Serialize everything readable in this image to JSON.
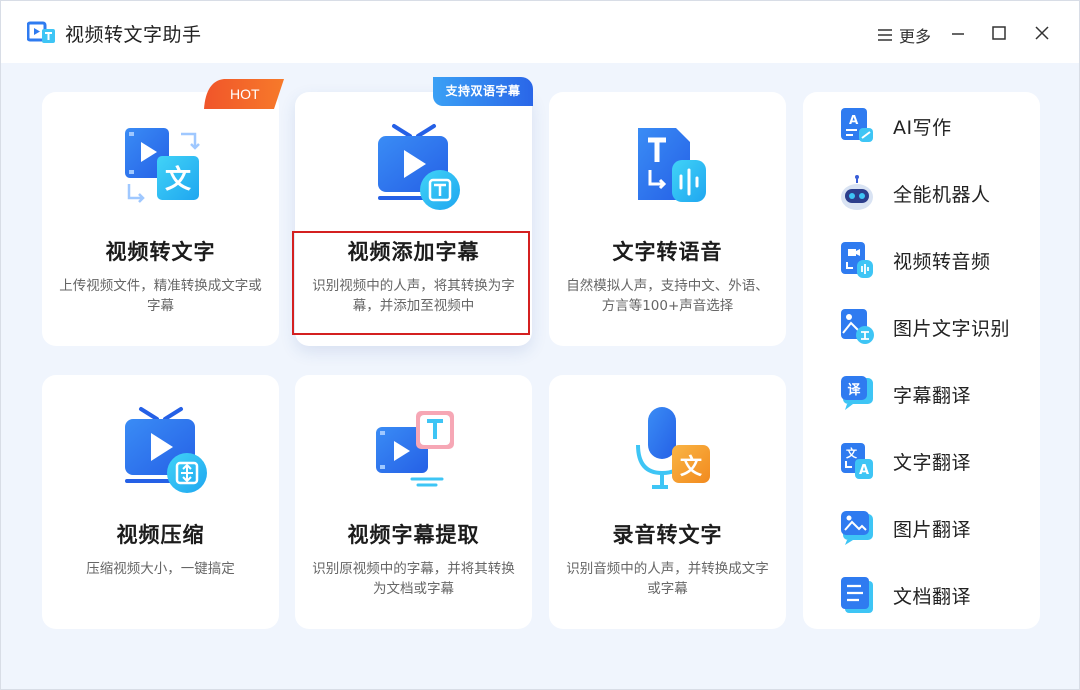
{
  "window": {
    "title": "视频转文字助手",
    "more_label": "更多"
  },
  "cards": [
    {
      "title": "视频转文字",
      "desc": "上传视频文件，精准转换成文字或字幕",
      "badge": "HOT"
    },
    {
      "title": "视频添加字幕",
      "desc": "识别视频中的人声，将其转换为字幕，并添加至视频中",
      "badge": "支持双语字幕"
    },
    {
      "title": "文字转语音",
      "desc": "自然模拟人声，支持中文、外语、方言等100+声音选择"
    },
    {
      "title": "视频压缩",
      "desc": "压缩视频大小，一键搞定"
    },
    {
      "title": "视频字幕提取",
      "desc": "识别原视频中的字幕，并将其转换为文档或字幕"
    },
    {
      "title": "录音转文字",
      "desc": "识别音频中的人声，并转换成文字或字幕"
    }
  ],
  "sidebar": {
    "items": [
      {
        "label": "AI写作",
        "icon": "ai-writing-icon"
      },
      {
        "label": "全能机器人",
        "icon": "robot-icon"
      },
      {
        "label": "视频转音频",
        "icon": "video-to-audio-icon"
      },
      {
        "label": "图片文字识别",
        "icon": "image-ocr-icon"
      },
      {
        "label": "字幕翻译",
        "icon": "subtitle-translate-icon"
      },
      {
        "label": "文字翻译",
        "icon": "text-translate-icon"
      },
      {
        "label": "图片翻译",
        "icon": "image-translate-icon"
      },
      {
        "label": "文档翻译",
        "icon": "document-translate-icon"
      }
    ]
  },
  "colors": {
    "accent": "#2f7bf0",
    "accent_light": "#3ec5f5",
    "hot": "#f04a1f",
    "orange": "#f59a2a",
    "highlight": "#d42020",
    "background": "#f0f5fd"
  }
}
